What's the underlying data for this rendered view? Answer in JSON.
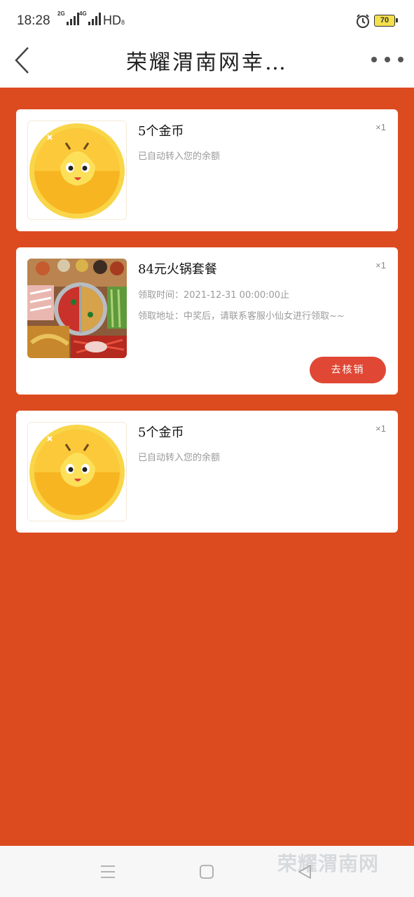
{
  "status_bar": {
    "time": "18:28",
    "sim1_tag": "2G",
    "sim2_tag": "4G",
    "hd": "HD",
    "hd_sub": "8",
    "battery": "70",
    "alarm_icon": "alarm-clock-icon"
  },
  "nav": {
    "title": "荣耀渭南网幸…",
    "back_icon": "chevron-left-icon",
    "more_icon": "more-dots-icon"
  },
  "colors": {
    "page_background": "#dc4b20",
    "button": "#e04835",
    "coin": "#f7b521"
  },
  "prizes": [
    {
      "title": "5个金币",
      "quantity": "×1",
      "description": "已自动转入您的余额",
      "image": "gold-coin-icon"
    },
    {
      "title": "84元火锅套餐",
      "quantity": "×1",
      "time_line": "领取时间：2021-12-31 00:00:00止",
      "address_line": "领取地址：中奖后，请联系客服小仙女进行领取~~",
      "button_label": "去核销",
      "image": "hotpot-photo"
    },
    {
      "title": "5个金币",
      "quantity": "×1",
      "description": "已自动转入您的余额",
      "image": "gold-coin-icon"
    }
  ],
  "system_nav": {
    "menu_icon": "menu-icon",
    "home_icon": "home-square-icon",
    "back_icon": "back-triangle-icon",
    "watermark": "荣耀渭南网"
  }
}
